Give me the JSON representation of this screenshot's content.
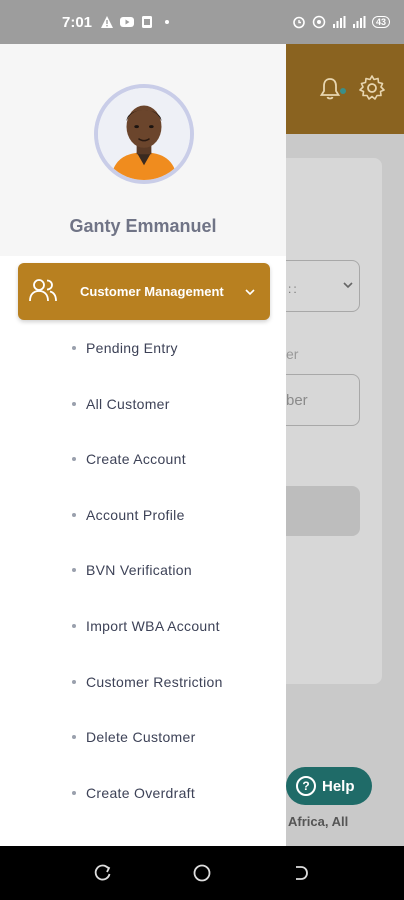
{
  "status_bar": {
    "time": "7:01",
    "battery": "43"
  },
  "drawer": {
    "user_name": "Ganty Emmanuel",
    "section": {
      "label": "Customer Management",
      "icon": "users-icon",
      "items": [
        {
          "label": "Pending Entry"
        },
        {
          "label": "All Customer"
        },
        {
          "label": "Create Account"
        },
        {
          "label": "Account Profile"
        },
        {
          "label": "BVN Verification"
        },
        {
          "label": "Import WBA Account"
        },
        {
          "label": "Customer Restriction"
        },
        {
          "label": "Delete Customer"
        },
        {
          "label": "Create Overdraft"
        }
      ]
    }
  },
  "background": {
    "select_value": "::",
    "field_label": "er",
    "field_placeholder": "ber",
    "help_label": "Help",
    "footer_text": "Africa, All"
  },
  "colors": {
    "accent": "#b88020",
    "header": "#8a6320",
    "help": "#1f6b68"
  }
}
